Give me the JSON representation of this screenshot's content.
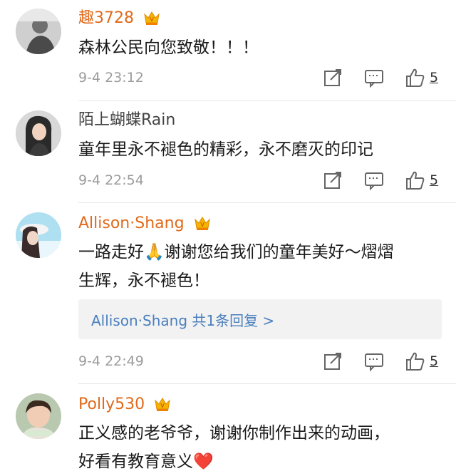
{
  "comments": [
    {
      "username": "趣3728",
      "vip": true,
      "text": "森林公民向您致敬！！！",
      "time": "9-4 23:12",
      "likes": "5"
    },
    {
      "username": "陌上蝴蝶Rain",
      "vip": false,
      "text": "童年里永不褪色的精彩，永不磨灭的印记",
      "time": "9-4 22:54",
      "likes": "5"
    },
    {
      "username": "Allison·Shang",
      "vip": true,
      "text_line1": "一路走好🙏谢谢您给我们的童年美好～熠熠",
      "text_line2": "生辉，永不褪色！",
      "reply_link": "Allison·Shang  共1条回复 >",
      "time": "9-4 22:49",
      "likes": "5"
    },
    {
      "username": "Polly530",
      "vip": true,
      "text_line1": "正义感的老爷爷，谢谢你制作出来的动画，",
      "text_line2": "好看有教育意义",
      "text_emoji": "❤️"
    }
  ],
  "colors": {
    "vip_name": "#e06a1b",
    "link": "#4a7fbd",
    "meta": "#9b9b9b"
  },
  "icons": [
    "vip-crown-icon",
    "share-icon",
    "comment-icon",
    "like-icon",
    "heart-emoji",
    "pray-emoji"
  ]
}
